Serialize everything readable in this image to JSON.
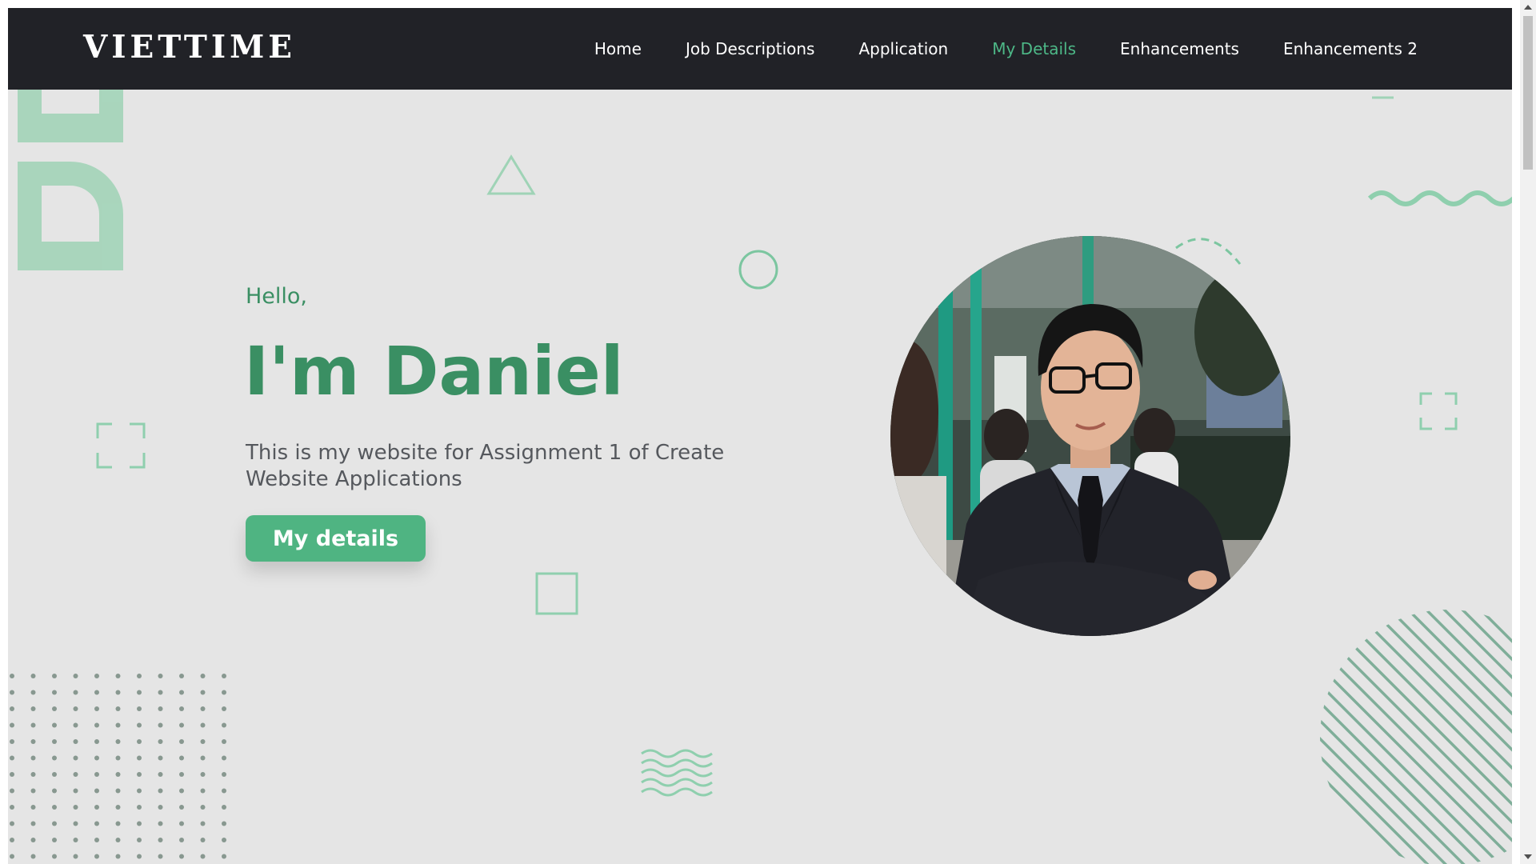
{
  "brand": {
    "logo_text": "VIETTIME"
  },
  "nav": {
    "items": [
      {
        "label": "Home",
        "active": false
      },
      {
        "label": "Job Descriptions",
        "active": false
      },
      {
        "label": "Application",
        "active": false
      },
      {
        "label": "My Details",
        "active": true
      },
      {
        "label": "Enhancements",
        "active": false
      },
      {
        "label": "Enhancements 2",
        "active": false
      }
    ]
  },
  "hero": {
    "greeting": "Hello,",
    "title": "I'm Daniel",
    "description": "This is my website for Assignment 1 of Create Website Applications",
    "cta_label": "My details"
  },
  "colors": {
    "accent": "#4db887",
    "heading": "#3a8f63",
    "nav_bg": "#212227",
    "page_bg": "#e5e5e5"
  }
}
